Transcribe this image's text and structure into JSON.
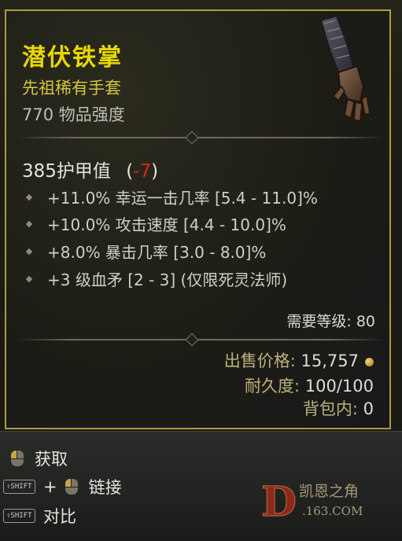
{
  "item": {
    "name": "潜伏铁掌",
    "type": "先祖稀有手套",
    "power": "770 物品强度",
    "armor_value": "385护甲值",
    "armor_paren_open": "(",
    "armor_delta": "-7",
    "armor_paren_close": ")",
    "affixes": [
      "+11.0% 幸运一击几率 [5.4 - 11.0]%",
      "+10.0% 攻击速度 [4.4 - 10.0]%",
      "+8.0% 暴击几率 [3.0 - 8.0]%",
      "+3 级血矛 [2 - 3] (仅限死灵法师)"
    ],
    "required_level": "需要等级: 80",
    "sell_label": "出售价格:",
    "sell_value": "15,757",
    "durability_label": "耐久度:",
    "durability_value": "100/100",
    "bag_label": "背包内:",
    "bag_value": "0",
    "icon": "gauntlet-icon"
  },
  "actions": {
    "obtain": "获取",
    "link_plus": "+",
    "link": "链接",
    "shift_key": "⇧SHIFT",
    "compare": "对比"
  },
  "watermark": {
    "letter": "D",
    "name": "凯恩之角",
    "url": ".163.COM"
  },
  "colors": {
    "legendary_name": "#e8d800",
    "negative_delta": "#e0241a",
    "frame_border": "#b09a3a"
  }
}
